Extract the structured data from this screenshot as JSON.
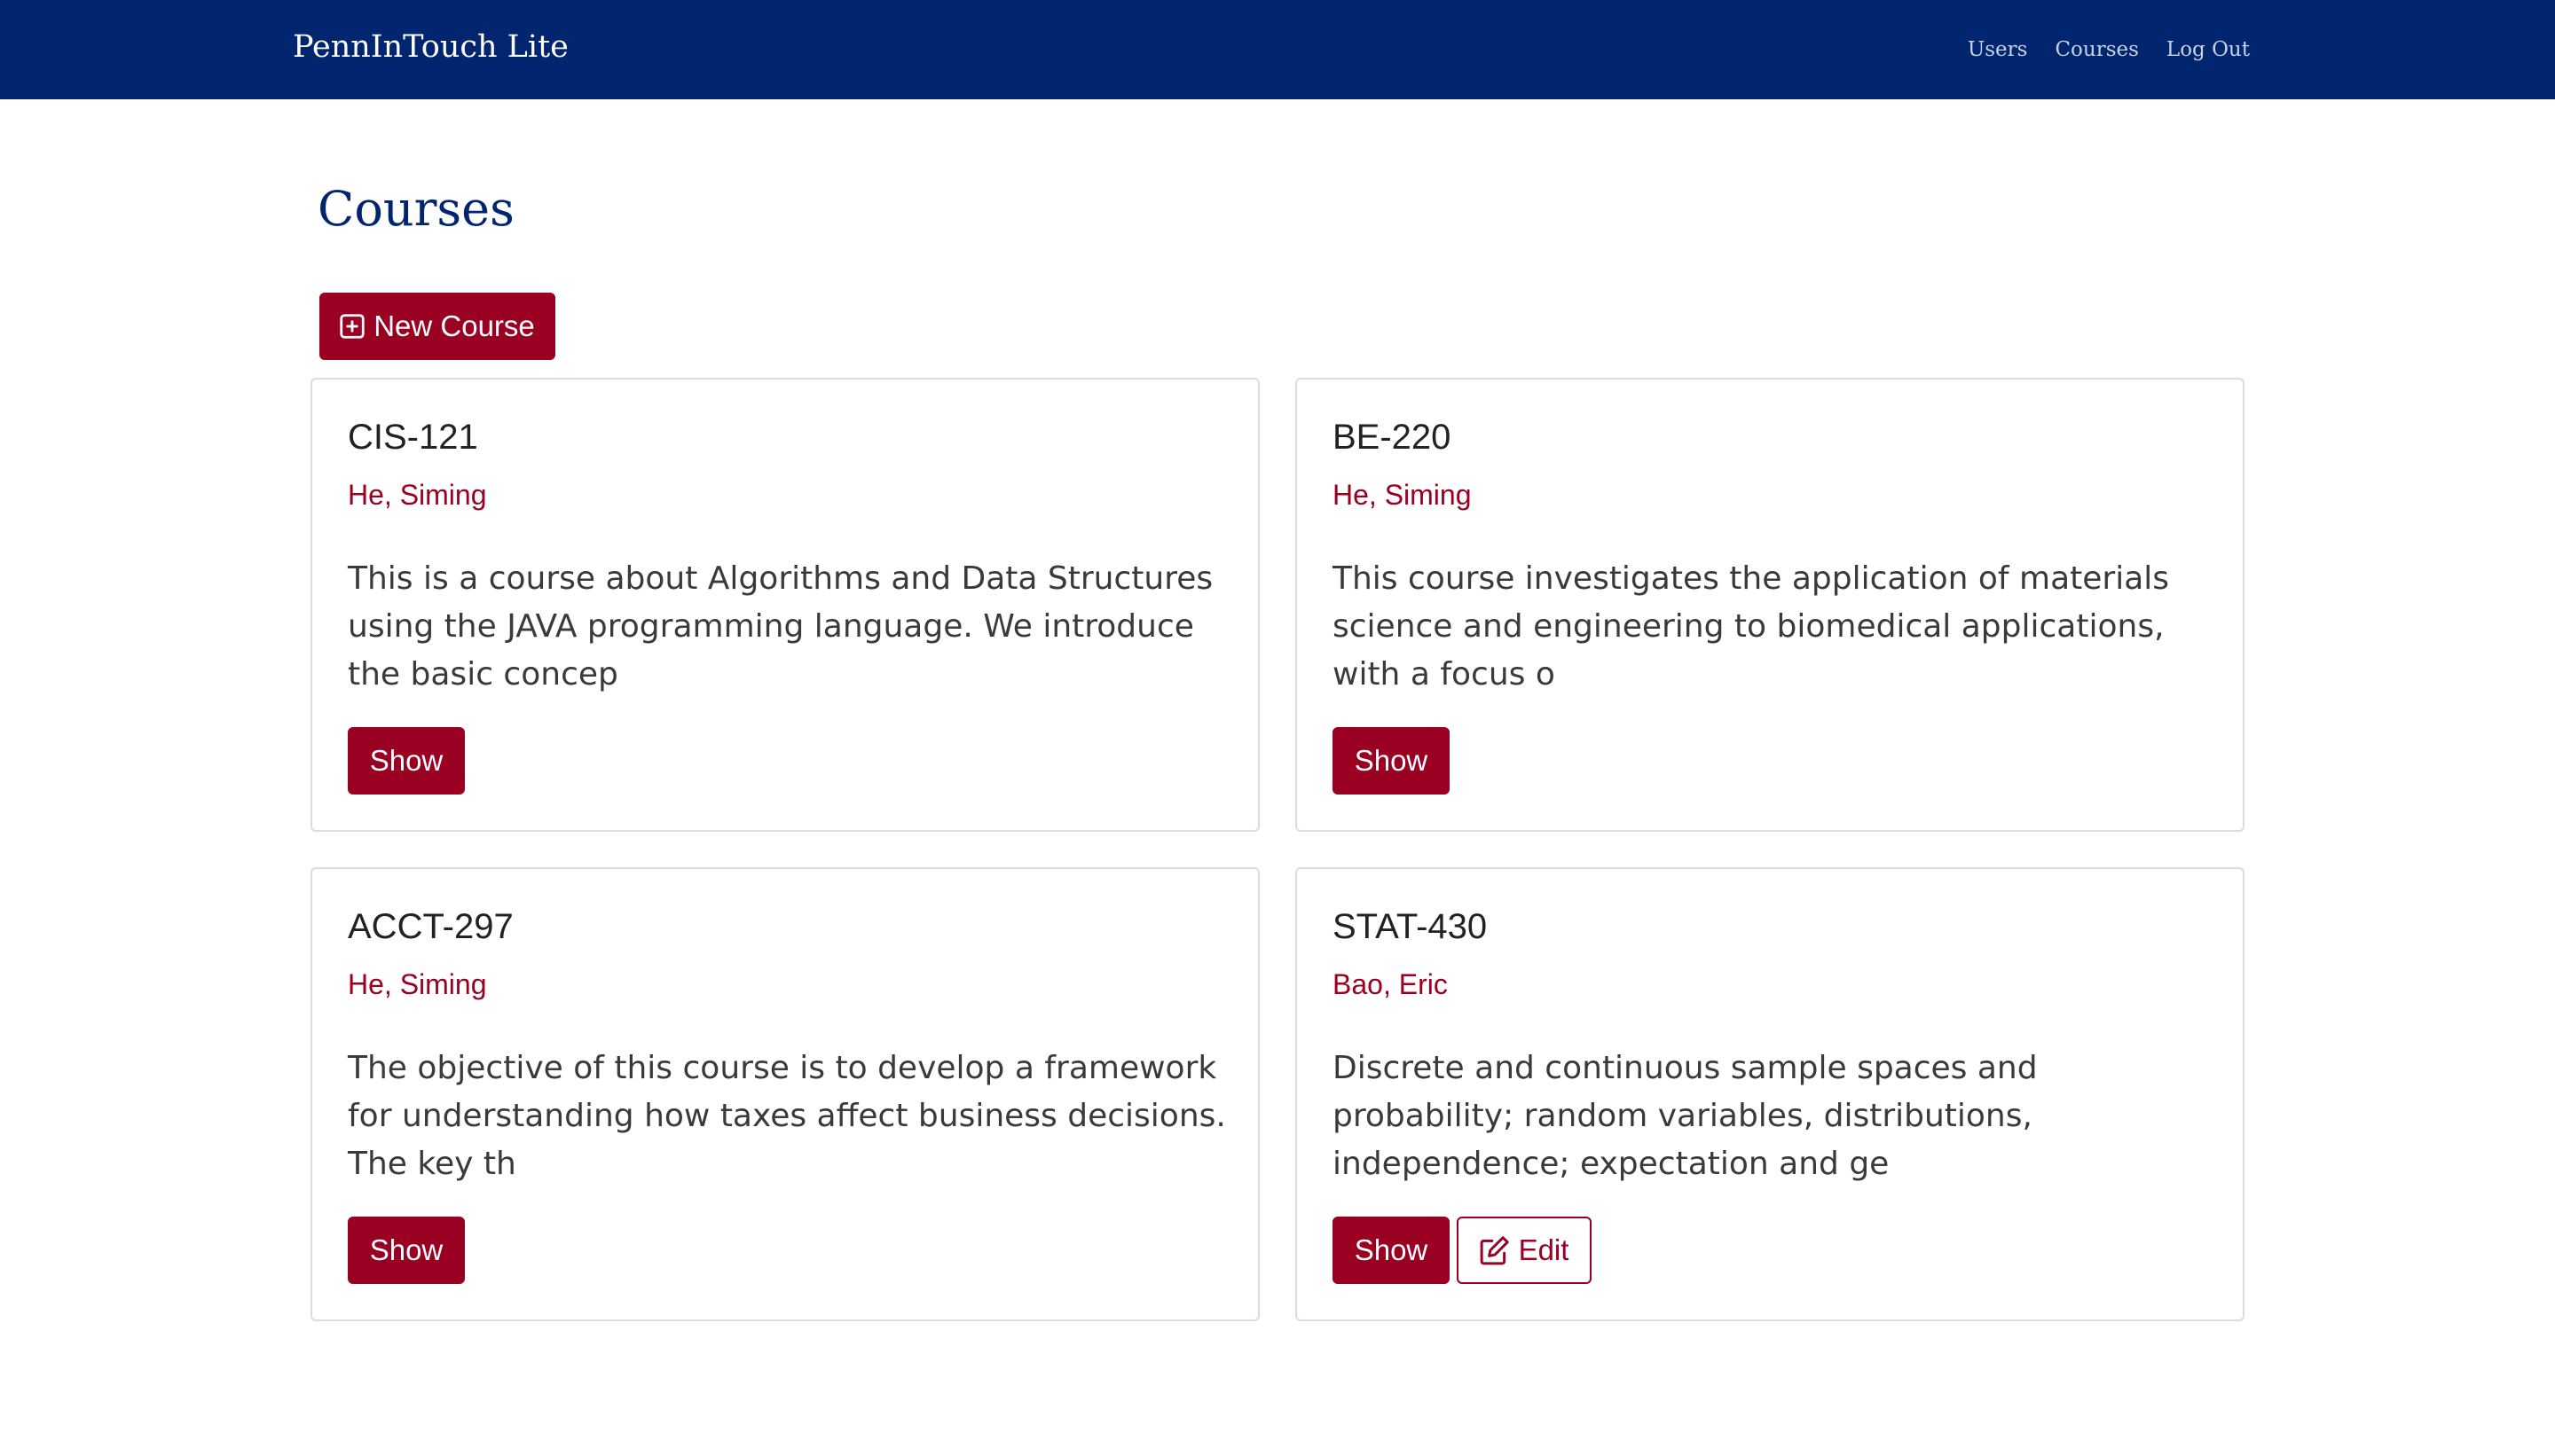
{
  "app": {
    "brand": "PennInTouch Lite",
    "nav": [
      {
        "label": "Users"
      },
      {
        "label": "Courses"
      },
      {
        "label": "Log Out"
      }
    ]
  },
  "page": {
    "title": "Courses",
    "new_course_label": "New Course"
  },
  "courses": [
    {
      "code": "CIS-121",
      "instructor": "He, Siming",
      "description": "This is a course about Algorithms and Data Structures using the JAVA programming language. We introduce the basic concep",
      "show_label": "Show"
    },
    {
      "code": "BE-220",
      "instructor": "He, Siming",
      "description": "This course investigates the application of materials science and engineering to biomedical applications, with a focus o",
      "show_label": "Show"
    },
    {
      "code": "ACCT-297",
      "instructor": "He, Siming",
      "description": "The objective of this course is to develop a framework for understanding how taxes affect business decisions. The key th",
      "show_label": "Show"
    },
    {
      "code": "STAT-430",
      "instructor": "Bao, Eric",
      "description": "Discrete and continuous sample spaces and probability; random variables, distributions, independence; expectation and ge",
      "show_label": "Show",
      "edit_label": "Edit"
    }
  ],
  "colors": {
    "navbar": "#01256e",
    "accent": "#990022",
    "title": "#01256e"
  },
  "icons": {
    "new_course": "plus-square-icon",
    "edit": "edit-icon"
  }
}
